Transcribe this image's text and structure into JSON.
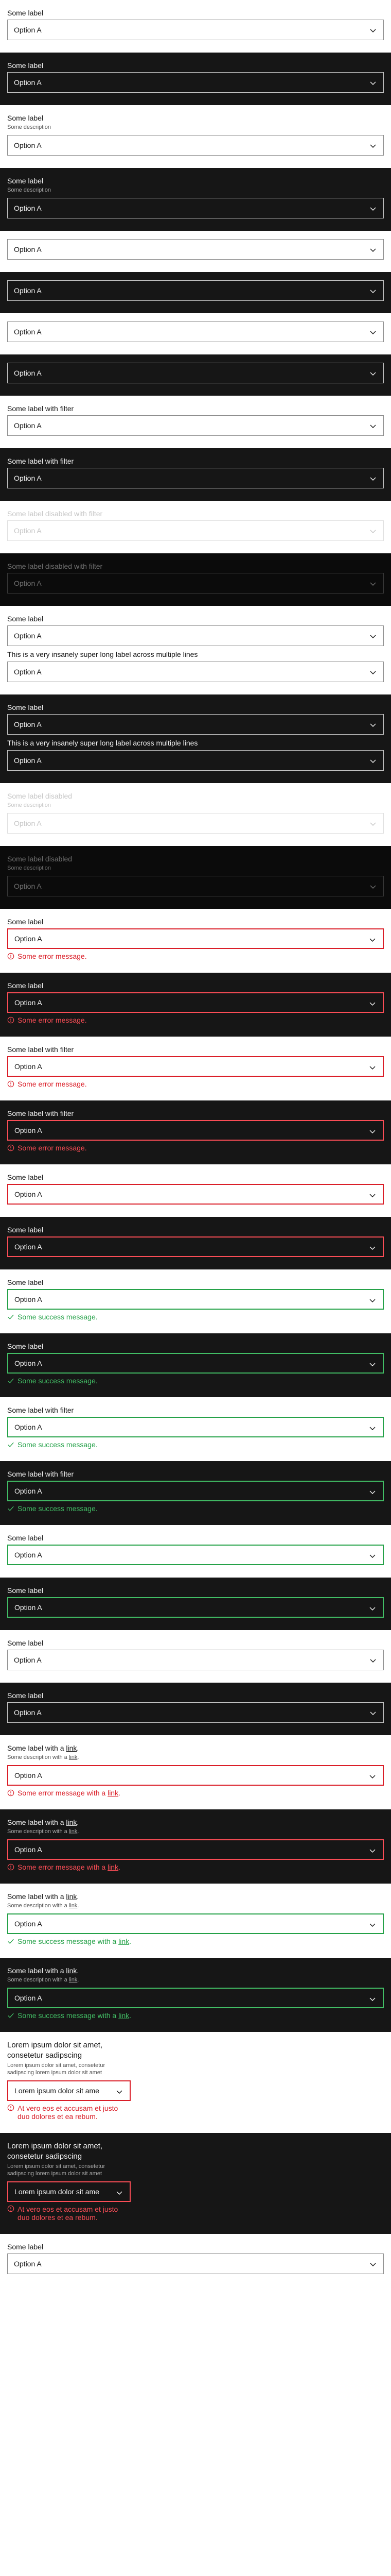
{
  "colors": {
    "error": "#da1e28",
    "success": "#24a148",
    "dark_bg": "#161616"
  },
  "icons": {
    "chevron": "chevron-down-icon",
    "error": "error-circle-icon",
    "success": "check-icon"
  },
  "blocks": [
    {
      "theme": "light",
      "label": "Some label",
      "value": "Option A"
    },
    {
      "theme": "dark",
      "label": "Some label",
      "value": "Option A"
    },
    {
      "theme": "light",
      "label": "Some label",
      "desc": "Some description",
      "value": "Option A"
    },
    {
      "theme": "dark",
      "label": "Some label",
      "desc": "Some description",
      "value": "Option A"
    },
    {
      "theme": "light",
      "value": "Option A"
    },
    {
      "theme": "dark",
      "value": "Option A"
    },
    {
      "theme": "light",
      "value": "Option A"
    },
    {
      "theme": "dark",
      "value": "Option A"
    },
    {
      "theme": "light",
      "label": "Some label with filter",
      "value": "Option A"
    },
    {
      "theme": "dark",
      "label": "Some label with filter",
      "value": "Option A"
    },
    {
      "theme": "light",
      "disabled": true,
      "label": "Some label disabled with filter",
      "value": "Option A"
    },
    {
      "theme": "dark",
      "disabled": true,
      "label": "Some label disabled with filter",
      "value": "Option A"
    },
    {
      "theme": "light",
      "label": "Some label",
      "value": "Option A",
      "long": "This is a very insanely super long label across multiple lines",
      "value2": "Option A"
    },
    {
      "theme": "dark",
      "label": "Some label",
      "value": "Option A",
      "long": "This is a very insanely super long label across multiple lines",
      "value2": "Option A"
    },
    {
      "theme": "light",
      "disabled": true,
      "label": "Some label disabled",
      "desc": "Some description",
      "value": "Option A"
    },
    {
      "theme": "dark",
      "disabled": true,
      "label": "Some label disabled",
      "desc": "Some description",
      "value": "Option A"
    },
    {
      "theme": "light",
      "label": "Some label",
      "value": "Option A",
      "state": "err",
      "msg": "Some error message."
    },
    {
      "theme": "dark",
      "label": "Some label",
      "value": "Option A",
      "state": "err",
      "msg": "Some error message."
    },
    {
      "theme": "light",
      "label": "Some label with filter",
      "value": "Option A",
      "state": "err",
      "msg": "Some error message."
    },
    {
      "theme": "dark",
      "label": "Some label with filter",
      "value": "Option A",
      "state": "err",
      "msg": "Some error message."
    },
    {
      "theme": "light",
      "label": "Some label",
      "value": "Option A",
      "state": "err"
    },
    {
      "theme": "dark",
      "label": "Some label",
      "value": "Option A",
      "state": "err"
    },
    {
      "theme": "light",
      "label": "Some label",
      "value": "Option A",
      "state": "ok",
      "msg": "Some success message."
    },
    {
      "theme": "dark",
      "label": "Some label",
      "value": "Option A",
      "state": "ok",
      "msg": "Some success message."
    },
    {
      "theme": "light",
      "label": "Some label with filter",
      "value": "Option A",
      "state": "ok",
      "msg": "Some success message."
    },
    {
      "theme": "dark",
      "label": "Some label with filter",
      "value": "Option A",
      "state": "ok",
      "msg": "Some success message."
    },
    {
      "theme": "light",
      "label": "Some label",
      "value": "Option A",
      "state": "ok"
    },
    {
      "theme": "dark",
      "label": "Some label",
      "value": "Option A",
      "state": "ok"
    },
    {
      "theme": "light",
      "label": "Some label",
      "value": "Option A"
    },
    {
      "theme": "dark",
      "label": "Some label",
      "value": "Option A"
    },
    {
      "theme": "light",
      "label": "Some label with a ",
      "label_link": "link",
      "label_end": ".",
      "desc": "Some description with a ",
      "desc_link": "link",
      "desc_end": ".",
      "value": "Option A",
      "state": "err",
      "msg": "Some error message with a ",
      "msg_link": "link",
      "msg_end": "."
    },
    {
      "theme": "dark",
      "label": "Some label with a ",
      "label_link": "link",
      "label_end": ".",
      "desc": "Some description with a ",
      "desc_link": "link",
      "desc_end": ".",
      "value": "Option A",
      "state": "err",
      "msg": "Some error message with a ",
      "msg_link": "link",
      "msg_end": "."
    },
    {
      "theme": "light",
      "label": "Some label with a ",
      "label_link": "link",
      "label_end": ".",
      "desc": "Some description with a ",
      "desc_link": "link",
      "desc_end": ".",
      "value": "Option A",
      "state": "ok",
      "msg": "Some success message with a ",
      "msg_link": "link",
      "msg_end": "."
    },
    {
      "theme": "dark",
      "label": "Some label with a ",
      "label_link": "link",
      "label_end": ".",
      "desc": "Some description with a ",
      "desc_link": "link",
      "desc_end": ".",
      "value": "Option A",
      "state": "ok",
      "msg": "Some success message with a ",
      "msg_link": "link",
      "msg_end": "."
    },
    {
      "theme": "light",
      "narrow": true,
      "label": "Lorem ipsum dolor sit amet, consetetur sadipscing",
      "desc": "Lorem ipsum dolor sit amet, consetetur sadipscing lorem ipsum dolor sit amet",
      "value": "Lorem ipsum dolor sit ame",
      "state": "err",
      "msg": "At vero eos et accusam et justo duo dolores et ea rebum."
    },
    {
      "theme": "dark",
      "narrow": true,
      "label": "Lorem ipsum dolor sit amet, consetetur sadipscing",
      "desc": "Lorem ipsum dolor sit amet, consetetur sadipscing lorem ipsum dolor sit amet",
      "value": "Lorem ipsum dolor sit ame",
      "state": "err",
      "msg": "At vero eos et accusam et justo duo dolores et ea rebum."
    },
    {
      "theme": "light",
      "label": "Some label",
      "value": "Option A"
    }
  ]
}
